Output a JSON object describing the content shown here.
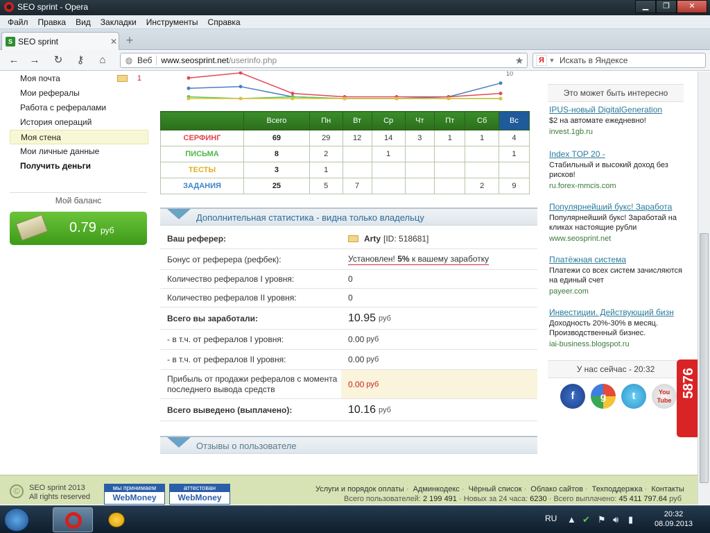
{
  "window": {
    "title": "SEO sprint - Opera"
  },
  "menu": [
    "Файл",
    "Правка",
    "Вид",
    "Закладки",
    "Инструменты",
    "Справка"
  ],
  "tab": {
    "label": "SEO sprint"
  },
  "nav": {
    "web_label": "Веб",
    "url_host": "www.seosprint.net",
    "url_path": "/userinfo.php",
    "search_placeholder": "Искать в Яндексе"
  },
  "leftmenu": {
    "items": [
      {
        "label": "Моя почта",
        "badge": "1"
      },
      {
        "label": "Мои рефералы"
      },
      {
        "label": "Работа с рефералами"
      },
      {
        "label": "История операций"
      },
      {
        "label": "Моя стена"
      },
      {
        "label": "Мои личные данные"
      },
      {
        "label": "Получить деньги"
      }
    ],
    "balance_title": "Мой баланс",
    "balance_value": "0.79",
    "balance_currency": "руб"
  },
  "chart_data": {
    "type": "line",
    "categories": [
      "Пн",
      "Вт",
      "Ср",
      "Чт",
      "Пт",
      "Сб",
      "Вс"
    ],
    "annotation": "10",
    "series": [
      {
        "color": "#4a7fc2",
        "values": [
          6,
          7,
          1,
          0,
          0,
          1,
          9
        ]
      },
      {
        "color": "#e04a56",
        "values": [
          12,
          15,
          3,
          1,
          1,
          1,
          3
        ]
      },
      {
        "color": "#5ac84a",
        "values": [
          1,
          0,
          1,
          0,
          0,
          0,
          0
        ]
      },
      {
        "color": "#e0c040",
        "values": [
          0,
          0,
          0,
          0,
          0,
          0,
          0
        ]
      }
    ]
  },
  "weekstats": {
    "headers": [
      "Всего",
      "Пн",
      "Вт",
      "Ср",
      "Чт",
      "Пт",
      "Сб",
      "Вс"
    ],
    "rows": [
      {
        "label": "СЕРФИНГ",
        "color": "#e0454a",
        "total": "69",
        "days": [
          "29",
          "12",
          "14",
          "3",
          "1",
          "1",
          "4"
        ]
      },
      {
        "label": "ПИСЬМА",
        "color": "#4cb848",
        "total": "8",
        "days": [
          "2",
          "",
          "1",
          "",
          "",
          "",
          "1"
        ]
      },
      {
        "label": "ТЕСТЫ",
        "color": "#e0b020",
        "total": "3",
        "days": [
          "1",
          "",
          "",
          "",
          "",
          "",
          ""
        ]
      },
      {
        "label": "ЗАДАНИЯ",
        "color": "#3a86c8",
        "total": "25",
        "days": [
          "5",
          "7",
          "",
          "",
          "",
          "2",
          "9"
        ]
      }
    ]
  },
  "extra": {
    "title": "Дополнительная статистика - видна только владельцу",
    "referer_label": "Ваш реферер:",
    "referer_name": "Arty",
    "referer_id": "[ID: 518681]",
    "bonus_label": "Бонус от реферера (рефбек):",
    "bonus_pre": "Установлен!",
    "bonus_pct": "5%",
    "bonus_post": "к вашему заработку",
    "ref1_label": "Количество рефералов I уровня:",
    "ref1_value": "0",
    "ref2_label": "Количество рефералов II уровня:",
    "ref2_value": "0",
    "earned_label": "Всего вы заработали:",
    "earned_value": "10.95",
    "earned_ref1_label": "- в т.ч. от рефералов I уровня:",
    "earned_ref1_value": "0.00",
    "earned_ref2_label": "- в т.ч. от рефералов II уровня:",
    "earned_ref2_value": "0.00",
    "profit_label": "Прибыль от продажи рефералов с момента последнего вывода средств",
    "profit_value": "0.00",
    "withdrawn_label": "Всего выведено (выплачено):",
    "withdrawn_value": "10.16",
    "currency": "руб"
  },
  "reviews": {
    "title": "Отзывы о пользователе"
  },
  "ads": {
    "header": "Это может быть интересно",
    "items": [
      {
        "title": "IPUS-новый DigitalGeneration",
        "desc": "$2 на автомате ежедневно!",
        "link": "invest.1gb.ru"
      },
      {
        "title": "Index TOP 20 -",
        "desc": "Стабильный и высокий доход без рисков!",
        "link": "ru.forex-mmcis.com"
      },
      {
        "title": "Популярнейший букс! Заработа",
        "desc": "Популярнейший букс! Заработай на кликах настоящие рубли",
        "link": "www.seosprint.net"
      },
      {
        "title": "Платёжная система",
        "desc": "Платежи со всех систем зачисляются на единый счет",
        "link": "payeer.com"
      },
      {
        "title": "Инвестиции. Действующий бизн",
        "desc": "Доходность 20%-30% в месяц. Производственный бизнес.",
        "link": "iai-business.blogspot.ru"
      }
    ],
    "now_label": "У нас сейчас - 20:32",
    "online_count": "5876"
  },
  "social": [
    "f",
    "g",
    "t",
    "You Tube"
  ],
  "footer": {
    "copy1": "SEO sprint 2013",
    "copy2": "All rights reserved",
    "wm1_top": "мы принимаем",
    "wm1_bot": "WebMoney",
    "wm2_top": "аттестован",
    "wm2_bot": "WebMoney",
    "links": [
      "Услуги и порядок оплаты",
      "Админкодекс",
      "Чёрный список",
      "Облако сайтов",
      "Техподдержка",
      "Контакты"
    ],
    "users_label": "Всего пользователей:",
    "users_value": "2 199 491",
    "new_label": "Новых за 24 часа:",
    "new_value": "6230",
    "paid_label": "Всего выплачено:",
    "paid_value": "45 411 797.64",
    "paid_cur": "руб"
  },
  "taskbar": {
    "lang": "RU",
    "time": "20:32",
    "date": "08.09.2013"
  }
}
